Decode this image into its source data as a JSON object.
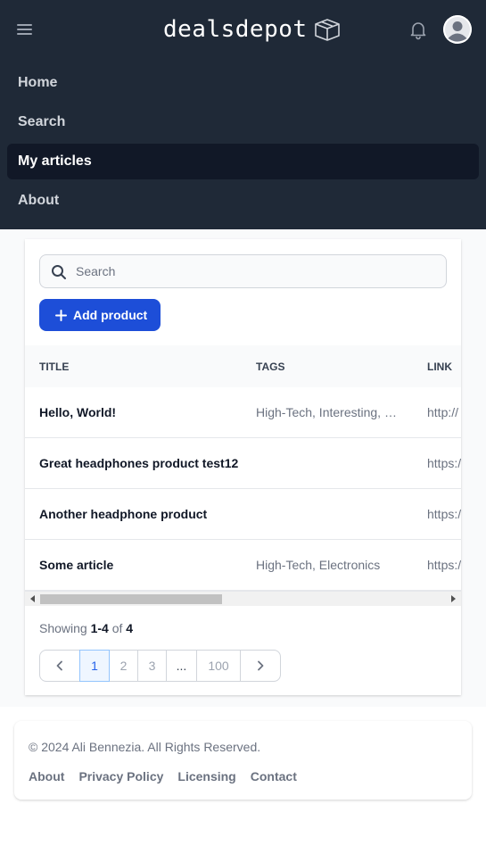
{
  "brand": {
    "name": "dealsdepot"
  },
  "nav": {
    "items": [
      {
        "label": "Home"
      },
      {
        "label": "Search"
      },
      {
        "label": "My articles"
      },
      {
        "label": "About"
      }
    ],
    "active": "My articles"
  },
  "toolbar": {
    "search_placeholder": "Search",
    "add_label": "Add product"
  },
  "table": {
    "columns": [
      "TITLE",
      "TAGS",
      "LINK"
    ],
    "rows": [
      {
        "title": "Hello, World!",
        "tags": "High-Tech, Interesting, S...",
        "link": "http://"
      },
      {
        "title": "Great headphones product test12",
        "tags": "",
        "link": "https:/"
      },
      {
        "title": "Another headphone product",
        "tags": "",
        "link": "https:/"
      },
      {
        "title": "Some article",
        "tags": "High-Tech, Electronics",
        "link": "https:/"
      }
    ]
  },
  "pagination": {
    "showing_prefix": "Showing",
    "range": "1-4",
    "of_word": "of",
    "total": "4",
    "pages": [
      "1",
      "2",
      "3",
      "...",
      "100"
    ],
    "current": "1"
  },
  "footer": {
    "copyright": "© 2024 Ali Bennezia. All Rights Reserved.",
    "links": [
      "About",
      "Privacy Policy",
      "Licensing",
      "Contact"
    ]
  },
  "colors": {
    "header_bg": "#1f2937",
    "active_nav_bg": "#111827",
    "primary": "#1d4ed8"
  },
  "icons": [
    "menu-icon",
    "box-icon",
    "bell-icon",
    "user-avatar-icon",
    "search-icon",
    "plus-icon",
    "chevron-left-icon",
    "chevron-right-icon"
  ]
}
